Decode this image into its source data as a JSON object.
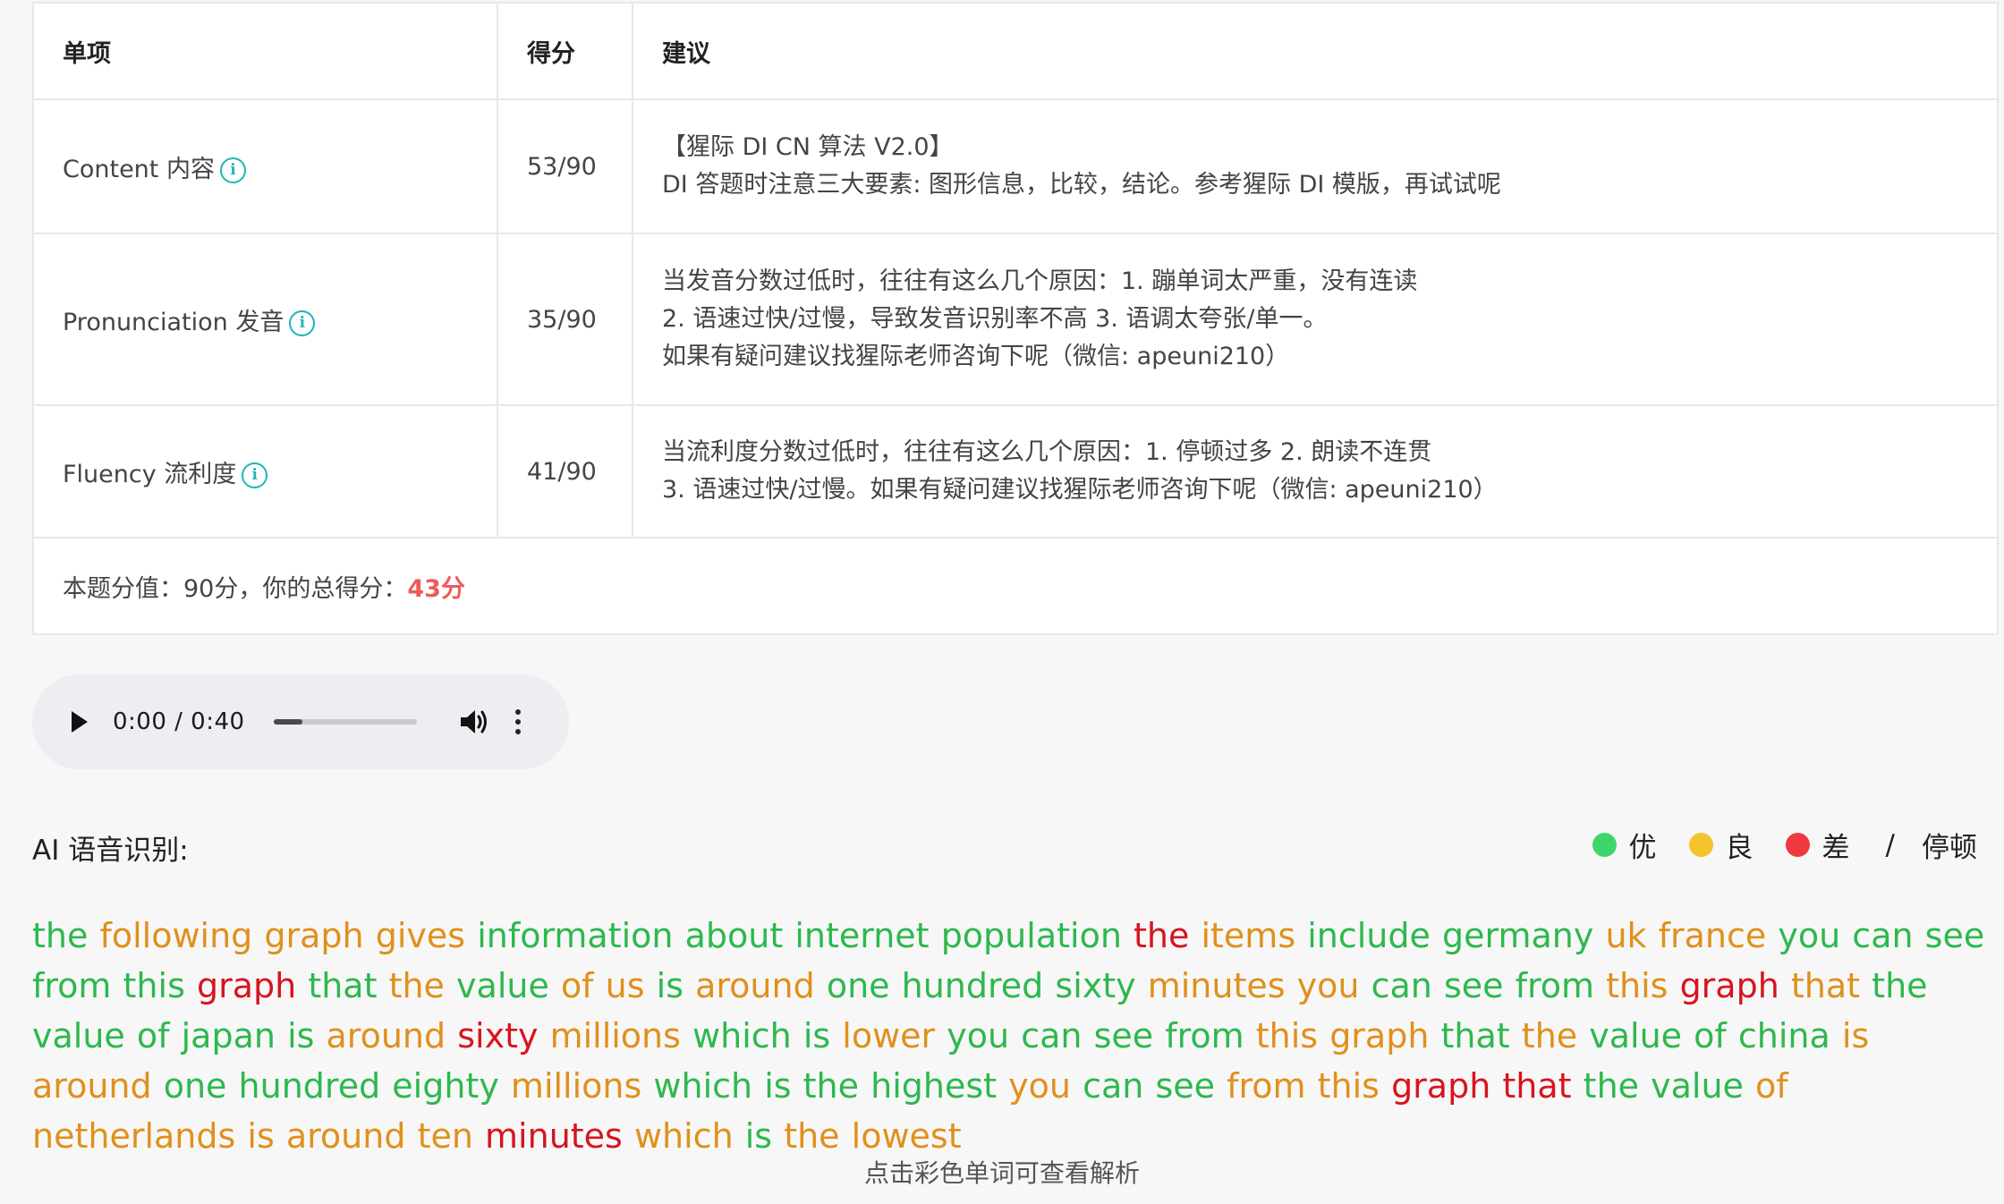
{
  "table": {
    "headers": [
      "单项",
      "得分",
      "建议"
    ],
    "rows": [
      {
        "label": "Content 内容",
        "score": "53/90",
        "advice": [
          "【猩际 DI CN 算法 V2.0】",
          "DI 答题时注意三大要素: 图形信息，比较，结论。参考猩际 DI 模版，再试试呢"
        ]
      },
      {
        "label": "Pronunciation 发音",
        "score": "35/90",
        "advice": [
          "当发音分数过低时，往往有这么几个原因：1. 蹦单词太严重，没有连读",
          "2. 语速过快/过慢，导致发音识别率不高 3. 语调太夸张/单一。",
          "如果有疑问建议找猩际老师咨询下呢（微信: apeuni210）"
        ]
      },
      {
        "label": "Fluency 流利度",
        "score": "41/90",
        "advice": [
          "当流利度分数过低时，往往有这么几个原因：1. 停顿过多 2. 朗读不连贯",
          "3. 语速过快/过慢。如果有疑问建议找猩际老师咨询下呢（微信: apeuni210）"
        ]
      }
    ],
    "total_prefix": "本题分值：90分，你的总得分：",
    "total_score": "43分",
    "info_icon": "i"
  },
  "audio": {
    "time": "0:00 / 0:40",
    "progress": 0.2
  },
  "ai": {
    "title": "AI 语音识别:",
    "legend": {
      "good": "优",
      "ok": "良",
      "bad": "差",
      "slash": "/",
      "pause": "停顿"
    },
    "colors": {
      "good": "#2db84d",
      "ok": "#e0901c",
      "bad": "#d7141f"
    }
  },
  "transcript": [
    [
      "the",
      "good"
    ],
    [
      "following",
      "ok"
    ],
    [
      "graph",
      "ok"
    ],
    [
      "gives",
      "ok"
    ],
    [
      "information",
      "good"
    ],
    [
      "about",
      "good"
    ],
    [
      "internet",
      "good"
    ],
    [
      "population",
      "good"
    ],
    [
      "the",
      "bad"
    ],
    [
      "items",
      "ok"
    ],
    [
      "include",
      "good"
    ],
    [
      "germany",
      "good"
    ],
    [
      "uk",
      "ok"
    ],
    [
      "france",
      "ok"
    ],
    [
      "you",
      "good"
    ],
    [
      "can",
      "good"
    ],
    [
      "see",
      "good"
    ],
    [
      "from",
      "good"
    ],
    [
      "this",
      "good"
    ],
    [
      "graph",
      "bad"
    ],
    [
      "that",
      "good"
    ],
    [
      "the",
      "ok"
    ],
    [
      "value",
      "good"
    ],
    [
      "of",
      "ok"
    ],
    [
      "us",
      "ok"
    ],
    [
      "is",
      "good"
    ],
    [
      "around",
      "ok"
    ],
    [
      "one",
      "good"
    ],
    [
      "hundred",
      "good"
    ],
    [
      "sixty",
      "good"
    ],
    [
      "minutes",
      "ok"
    ],
    [
      "you",
      "ok"
    ],
    [
      "can",
      "good"
    ],
    [
      "see",
      "good"
    ],
    [
      "from",
      "good"
    ],
    [
      "this",
      "ok"
    ],
    [
      "graph",
      "bad"
    ],
    [
      "that",
      "ok"
    ],
    [
      "the",
      "good"
    ],
    [
      "value",
      "good"
    ],
    [
      "of",
      "good"
    ],
    [
      "japan",
      "good"
    ],
    [
      "is",
      "good"
    ],
    [
      "around",
      "ok"
    ],
    [
      "sixty",
      "bad"
    ],
    [
      "millions",
      "ok"
    ],
    [
      "which",
      "good"
    ],
    [
      "is",
      "good"
    ],
    [
      "lower",
      "ok"
    ],
    [
      "you",
      "good"
    ],
    [
      "can",
      "good"
    ],
    [
      "see",
      "good"
    ],
    [
      "from",
      "good"
    ],
    [
      "this",
      "ok"
    ],
    [
      "graph",
      "ok"
    ],
    [
      "that",
      "good"
    ],
    [
      "the",
      "ok"
    ],
    [
      "value",
      "good"
    ],
    [
      "of",
      "good"
    ],
    [
      "china",
      "good"
    ],
    [
      "is",
      "ok"
    ],
    [
      "around",
      "ok"
    ],
    [
      "one",
      "good"
    ],
    [
      "hundred",
      "good"
    ],
    [
      "eighty",
      "good"
    ],
    [
      "millions",
      "ok"
    ],
    [
      "which",
      "good"
    ],
    [
      "is",
      "good"
    ],
    [
      "the",
      "good"
    ],
    [
      "highest",
      "good"
    ],
    [
      "you",
      "ok"
    ],
    [
      "can",
      "good"
    ],
    [
      "see",
      "good"
    ],
    [
      "from",
      "ok"
    ],
    [
      "this",
      "ok"
    ],
    [
      "graph",
      "bad"
    ],
    [
      "that",
      "bad"
    ],
    [
      "the",
      "good"
    ],
    [
      "value",
      "good"
    ],
    [
      "of",
      "ok"
    ],
    [
      "netherlands",
      "ok"
    ],
    [
      "is",
      "ok"
    ],
    [
      "around",
      "ok"
    ],
    [
      "ten",
      "ok"
    ],
    [
      "minutes",
      "bad"
    ],
    [
      "which",
      "ok"
    ],
    [
      "is",
      "good"
    ],
    [
      "the",
      "ok"
    ],
    [
      "lowest",
      "ok"
    ]
  ],
  "hint": "点击彩色单词可查看解析"
}
